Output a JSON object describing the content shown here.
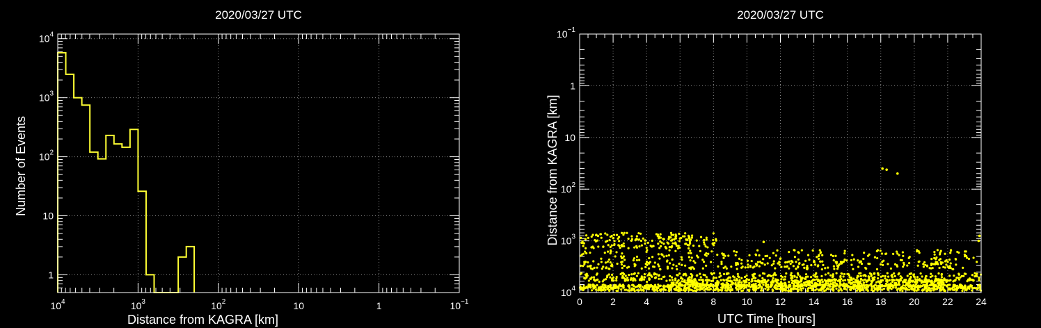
{
  "chart_data": [
    {
      "type": "histogram",
      "title": "2020/03/27 UTC",
      "xlabel": "Distance from KAGRA [km]",
      "ylabel": "Number of Events",
      "x_scale": "log-reversed",
      "y_scale": "log",
      "xlim": [
        10000,
        0.1
      ],
      "ylim": [
        0.5,
        12000
      ],
      "grid": true,
      "line_color": "#ffff33",
      "x_ticks": [
        {
          "base": "10",
          "exp": "4",
          "value": 10000
        },
        {
          "base": "10",
          "exp": "3",
          "value": 1000
        },
        {
          "base": "10",
          "exp": "2",
          "value": 100
        },
        {
          "base": "10",
          "exp": "",
          "value": 10
        },
        {
          "base": "1",
          "exp": "",
          "value": 1
        },
        {
          "base": "10",
          "exp": "−1",
          "value": 0.1
        }
      ],
      "y_ticks": [
        {
          "base": "10",
          "exp": "4",
          "value": 10000
        },
        {
          "base": "10",
          "exp": "3",
          "value": 1000
        },
        {
          "base": "10",
          "exp": "2",
          "value": 100
        },
        {
          "base": "10",
          "exp": "",
          "value": 10
        },
        {
          "base": "1",
          "exp": "",
          "value": 1
        }
      ],
      "bins": [
        {
          "from": 10000,
          "to": 7943,
          "count": 5800
        },
        {
          "from": 7943,
          "to": 6310,
          "count": 2500
        },
        {
          "from": 6310,
          "to": 5012,
          "count": 1000
        },
        {
          "from": 5012,
          "to": 3981,
          "count": 750
        },
        {
          "from": 3981,
          "to": 3162,
          "count": 120
        },
        {
          "from": 3162,
          "to": 2512,
          "count": 92
        },
        {
          "from": 2512,
          "to": 1995,
          "count": 230
        },
        {
          "from": 1995,
          "to": 1585,
          "count": 165
        },
        {
          "from": 1585,
          "to": 1259,
          "count": 145
        },
        {
          "from": 1259,
          "to": 1000,
          "count": 290
        },
        {
          "from": 1000,
          "to": 794,
          "count": 26
        },
        {
          "from": 794,
          "to": 631,
          "count": 1
        },
        {
          "from": 631,
          "to": 501,
          "count": 0
        },
        {
          "from": 501,
          "to": 398,
          "count": 0
        },
        {
          "from": 398,
          "to": 316,
          "count": 0
        },
        {
          "from": 316,
          "to": 251,
          "count": 2
        },
        {
          "from": 251,
          "to": 200,
          "count": 3
        }
      ]
    },
    {
      "type": "scatter",
      "title": "2020/03/27 UTC",
      "xlabel": "UTC Time [hours]",
      "ylabel": "Distance from KAGRA [km]",
      "y_scale": "log-reversed",
      "xlim": [
        0,
        24
      ],
      "ylim": [
        0.1,
        10000
      ],
      "grid": true,
      "marker_color": "#ffff00",
      "x_ticks": [
        "0",
        "2",
        "4",
        "6",
        "8",
        "10",
        "12",
        "14",
        "16",
        "18",
        "20",
        "22",
        "24"
      ],
      "y_ticks": [
        {
          "base": "10",
          "exp": "−1",
          "value": 0.1
        },
        {
          "base": "1",
          "exp": "",
          "value": 1
        },
        {
          "base": "10",
          "exp": "",
          "value": 10
        },
        {
          "base": "10",
          "exp": "2",
          "value": 100
        },
        {
          "base": "10",
          "exp": "3",
          "value": 1000
        },
        {
          "base": "10",
          "exp": "4",
          "value": 10000
        }
      ],
      "bands": [
        {
          "center_km": 1050,
          "spread_km": [
            700,
            1400
          ],
          "t_start": 0,
          "t_end": 8.2,
          "density": 22
        },
        {
          "center_km": 1900,
          "spread_km": [
            1500,
            2600
          ],
          "t_start": 0,
          "t_end": 24,
          "density": 8
        },
        {
          "center_km": 3000,
          "spread_km": [
            2500,
            3600
          ],
          "t_start": 0,
          "t_end": 23,
          "density": 10
        },
        {
          "center_km": 5000,
          "spread_km": [
            4200,
            6200
          ],
          "t_start": 0,
          "t_end": 24,
          "density": 18
        },
        {
          "center_km": 6500,
          "spread_km": [
            5600,
            7600
          ],
          "t_start": 5.5,
          "t_end": 22,
          "density": 30
        },
        {
          "center_km": 8000,
          "spread_km": [
            7000,
            9300
          ],
          "t_start": 0,
          "t_end": 24,
          "density": 35
        }
      ],
      "outliers": [
        {
          "t": 18.1,
          "km": 40
        },
        {
          "t": 18.35,
          "km": 42
        },
        {
          "t": 19.0,
          "km": 50
        },
        {
          "t": 23.9,
          "km": 800
        },
        {
          "t": 23.85,
          "km": 1000
        },
        {
          "t": 1.1,
          "km": 800
        },
        {
          "t": 11.0,
          "km": 1050
        }
      ]
    }
  ]
}
